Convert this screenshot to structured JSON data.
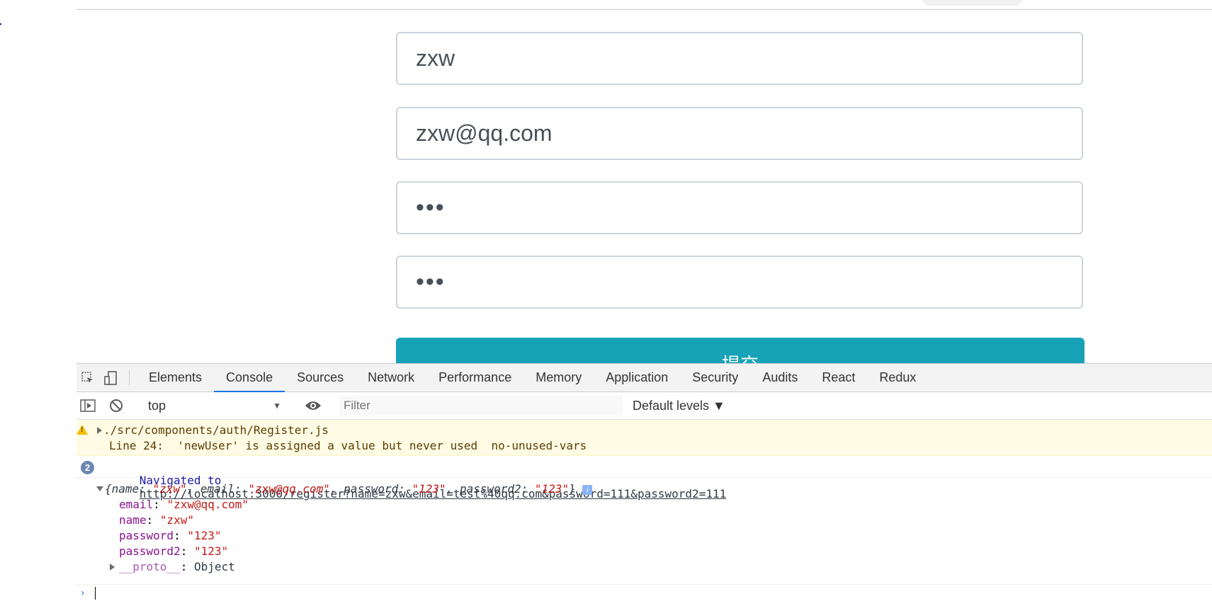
{
  "form": {
    "name_value": "zxw",
    "email_value": "zxw@qq.com",
    "password_value": "•••",
    "password2_value": "•••",
    "submit_label": "提交"
  },
  "devtools": {
    "tabs": [
      "Elements",
      "Console",
      "Sources",
      "Network",
      "Performance",
      "Memory",
      "Application",
      "Security",
      "Audits",
      "React",
      "Redux"
    ],
    "active_tab": "Console",
    "context": "top",
    "filter_placeholder": "Filter",
    "levels_label": "Default levels ▼",
    "warning": {
      "source": "./src/components/auth/Register.js",
      "detail": "Line 24:  'newUser' is assigned a value but never used  no-unused-vars"
    },
    "navigation": {
      "count": "2",
      "prefix": "Navigated to",
      "url": "http://localhost:3000/register?name=zxw&email=test%40qq.com&password=111&password2=111"
    },
    "object": {
      "summary_open": "{name: ",
      "summary_name": "\"zxw\"",
      "summary_sep1": ", email: ",
      "summary_email": "\"zxw@qq.com\"",
      "summary_sep2": ", password: ",
      "summary_password": "\"123\"",
      "summary_sep3": ", password2: ",
      "summary_password2": "\"123\"",
      "summary_close": "}",
      "props": [
        {
          "key": "email",
          "value": "\"zxw@qq.com\""
        },
        {
          "key": "name",
          "value": "\"zxw\""
        },
        {
          "key": "password",
          "value": "\"123\""
        },
        {
          "key": "password2",
          "value": "\"123\""
        }
      ],
      "proto_key": "__proto__",
      "proto_value": "Object"
    },
    "prompt_symbol": "›"
  }
}
